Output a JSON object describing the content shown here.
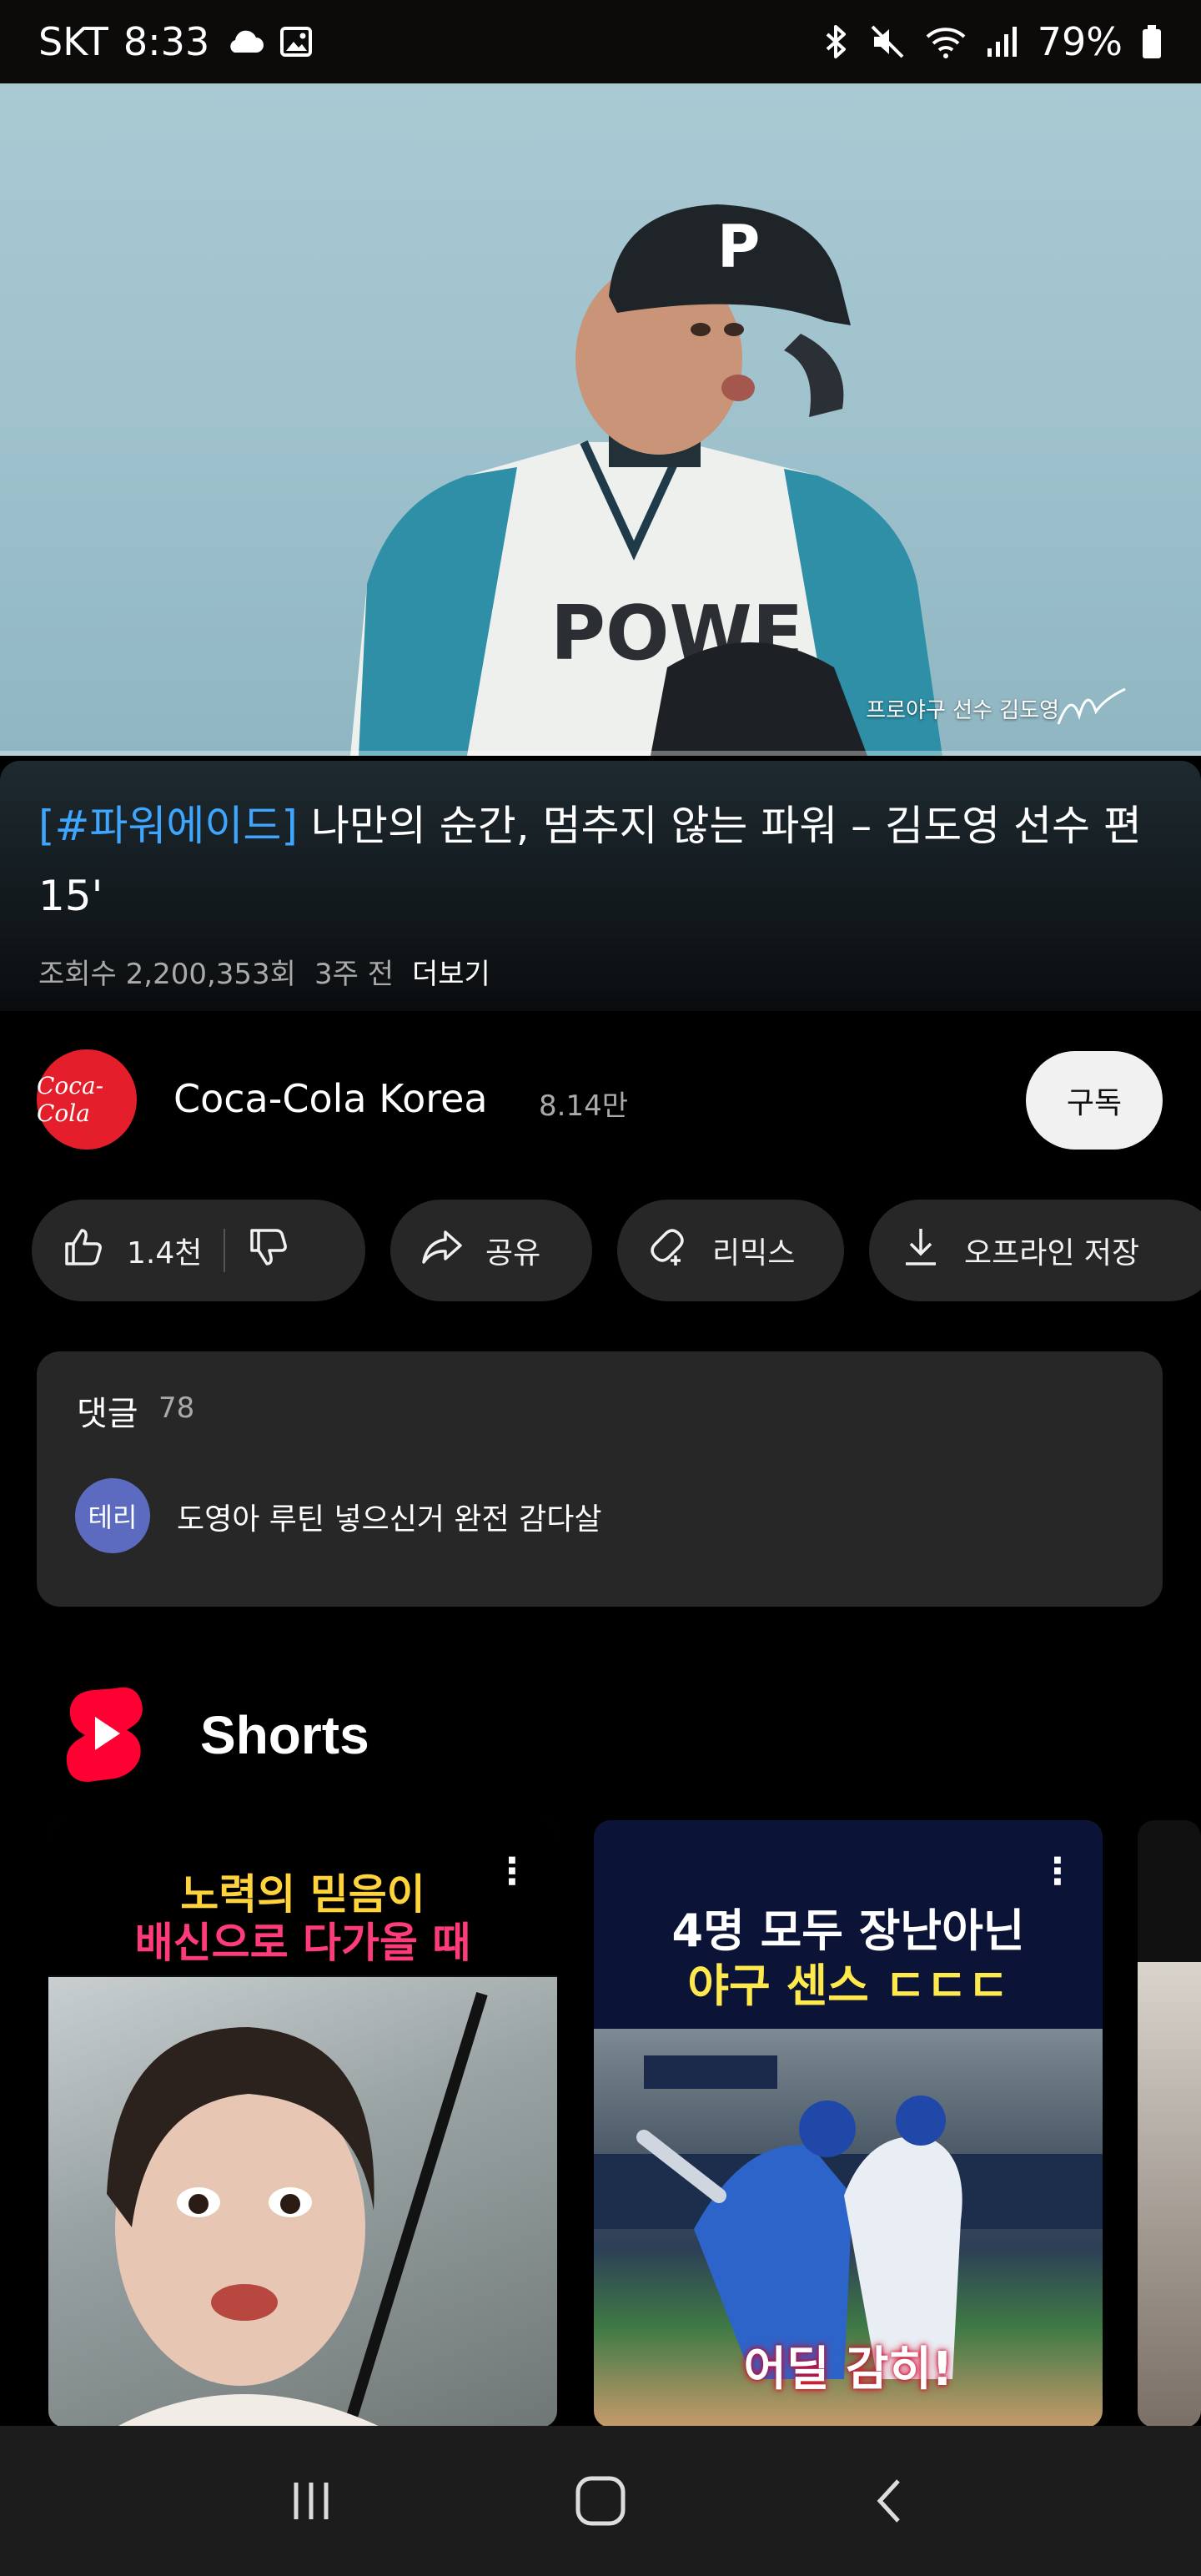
{
  "status_bar": {
    "carrier": "SKT",
    "time": "8:33",
    "battery": "79%",
    "icons": [
      "cloud-icon",
      "gallery-icon",
      "bluetooth-icon",
      "mute-icon",
      "wifi-icon",
      "signal-icon",
      "battery-icon"
    ]
  },
  "video": {
    "caption": "프로야구 선수 김도영",
    "progress": 0.0
  },
  "info": {
    "title_hashtag": "[#파워에이드]",
    "title_rest": " 나만의 순간, 멈추지 않는 파워 – 김도영 선수 편 15'",
    "views": "조회수 2,200,353회",
    "age": "3주 전",
    "more": "더보기"
  },
  "channel": {
    "avatar_text": "Coca-Cola",
    "name": "Coca-Cola Korea",
    "subscribers": "8.14만",
    "subscribe_label": "구독"
  },
  "actions": {
    "likes": "1.4천",
    "share": "공유",
    "remix": "리믹스",
    "download": "오프라인 저장"
  },
  "comments": {
    "heading": "댓글",
    "count": "78",
    "top_avatar": "테리",
    "top_text": "도영아 루틴 넣으신거 완전 감다살"
  },
  "shorts": {
    "title": "Shorts",
    "items": [
      {
        "line1": "노력의 믿음이",
        "line2": "배신으로 다가올 때"
      },
      {
        "line1": "4명 모두 장난아닌",
        "line2": "야구 센스 ㄷㄷㄷ",
        "bottom": "어딜 감히!"
      }
    ]
  },
  "accent_colors": {
    "youtube_red": "#ff0033",
    "link_blue": "#3ea6ff",
    "coke_red": "#e41e2b"
  }
}
